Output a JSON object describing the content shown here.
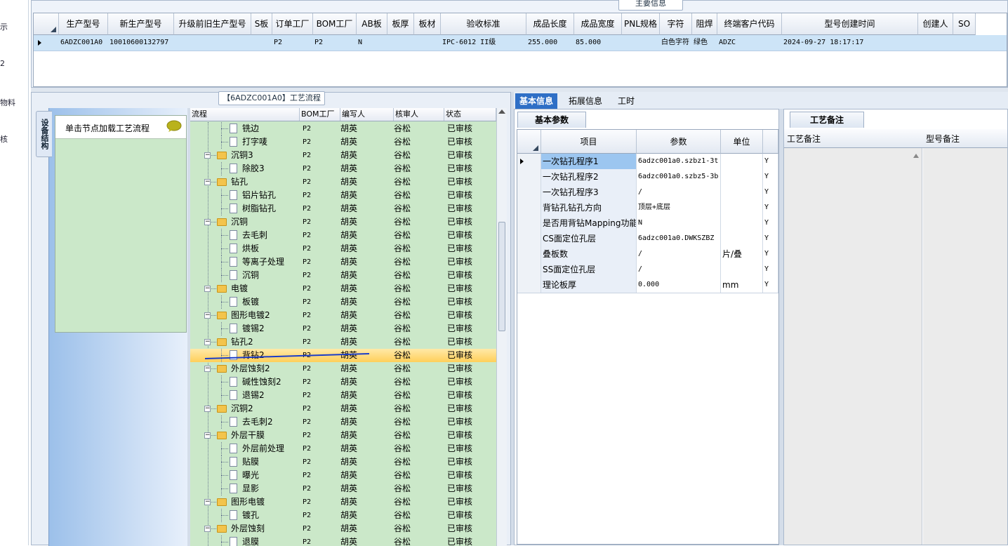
{
  "left_strip": [
    "示",
    "2",
    "物料",
    "核"
  ],
  "top": {
    "title": "主要信息",
    "columns": [
      "生产型号",
      "新生产型号",
      "升级前旧生产型号",
      "S板",
      "订单工厂",
      "BOM工厂",
      "AB板",
      "板厚",
      "板材",
      "验收标准",
      "成品长度",
      "成品宽度",
      "PNL规格",
      "字符",
      "阻焊",
      "终端客户代码",
      "型号创建时间",
      "创建人",
      "SO"
    ],
    "row": [
      "6ADZC001A0",
      "10010600132797",
      "",
      "",
      "P2",
      "P2",
      "N",
      "",
      "",
      "IPC-6012 II级",
      "255.000",
      "85.000",
      "",
      "白色字符",
      "绿色",
      "ADZC",
      "2024-09-27 18:17:17",
      "",
      ""
    ]
  },
  "process": {
    "title": "【6ADZC001A0】工艺流程",
    "side_tab": "设备结构",
    "hint": "单击节点加载工艺流程",
    "columns": [
      "流程",
      "BOM工厂",
      "编写人",
      "核审人",
      "状态"
    ],
    "rows": [
      {
        "name": "铣边",
        "level": 2,
        "bom": "P2",
        "author": "胡英",
        "reviewer": "谷松",
        "status": "已审核"
      },
      {
        "name": "打字唛",
        "level": 2,
        "bom": "P2",
        "author": "胡英",
        "reviewer": "谷松",
        "status": "已审核"
      },
      {
        "name": "沉铜3",
        "level": 1,
        "bom": "P2",
        "author": "胡英",
        "reviewer": "谷松",
        "status": "已审核"
      },
      {
        "name": "除胶3",
        "level": 2,
        "bom": "P2",
        "author": "胡英",
        "reviewer": "谷松",
        "status": "已审核"
      },
      {
        "name": "钻孔",
        "level": 1,
        "bom": "P2",
        "author": "胡英",
        "reviewer": "谷松",
        "status": "已审核"
      },
      {
        "name": "铝片钻孔",
        "level": 2,
        "bom": "P2",
        "author": "胡英",
        "reviewer": "谷松",
        "status": "已审核"
      },
      {
        "name": "树脂钻孔",
        "level": 2,
        "bom": "P2",
        "author": "胡英",
        "reviewer": "谷松",
        "status": "已审核"
      },
      {
        "name": "沉铜",
        "level": 1,
        "bom": "P2",
        "author": "胡英",
        "reviewer": "谷松",
        "status": "已审核"
      },
      {
        "name": "去毛刺",
        "level": 2,
        "bom": "P2",
        "author": "胡英",
        "reviewer": "谷松",
        "status": "已审核"
      },
      {
        "name": "烘板",
        "level": 2,
        "bom": "P2",
        "author": "胡英",
        "reviewer": "谷松",
        "status": "已审核"
      },
      {
        "name": "等离子处理",
        "level": 2,
        "bom": "P2",
        "author": "胡英",
        "reviewer": "谷松",
        "status": "已审核"
      },
      {
        "name": "沉铜",
        "level": 2,
        "bom": "P2",
        "author": "胡英",
        "reviewer": "谷松",
        "status": "已审核"
      },
      {
        "name": "电镀",
        "level": 1,
        "bom": "P2",
        "author": "胡英",
        "reviewer": "谷松",
        "status": "已审核"
      },
      {
        "name": "板镀",
        "level": 2,
        "bom": "P2",
        "author": "胡英",
        "reviewer": "谷松",
        "status": "已审核"
      },
      {
        "name": "图形电镀2",
        "level": 1,
        "bom": "P2",
        "author": "胡英",
        "reviewer": "谷松",
        "status": "已审核"
      },
      {
        "name": "镀锡2",
        "level": 2,
        "bom": "P2",
        "author": "胡英",
        "reviewer": "谷松",
        "status": "已审核"
      },
      {
        "name": "钻孔2",
        "level": 1,
        "bom": "P2",
        "author": "胡英",
        "reviewer": "谷松",
        "status": "已审核"
      },
      {
        "name": "背钻2",
        "level": 2,
        "bom": "P2",
        "author": "胡英",
        "reviewer": "谷松",
        "status": "已审核",
        "selected": true
      },
      {
        "name": "外层蚀刻2",
        "level": 1,
        "bom": "P2",
        "author": "胡英",
        "reviewer": "谷松",
        "status": "已审核"
      },
      {
        "name": "碱性蚀刻2",
        "level": 2,
        "bom": "P2",
        "author": "胡英",
        "reviewer": "谷松",
        "status": "已审核"
      },
      {
        "name": "退锡2",
        "level": 2,
        "bom": "P2",
        "author": "胡英",
        "reviewer": "谷松",
        "status": "已审核"
      },
      {
        "name": "沉铜2",
        "level": 1,
        "bom": "P2",
        "author": "胡英",
        "reviewer": "谷松",
        "status": "已审核"
      },
      {
        "name": "去毛刺2",
        "level": 2,
        "bom": "P2",
        "author": "胡英",
        "reviewer": "谷松",
        "status": "已审核"
      },
      {
        "name": "外层干膜",
        "level": 1,
        "bom": "P2",
        "author": "胡英",
        "reviewer": "谷松",
        "status": "已审核"
      },
      {
        "name": "外层前处理",
        "level": 2,
        "bom": "P2",
        "author": "胡英",
        "reviewer": "谷松",
        "status": "已审核"
      },
      {
        "name": "贴膜",
        "level": 2,
        "bom": "P2",
        "author": "胡英",
        "reviewer": "谷松",
        "status": "已审核"
      },
      {
        "name": "曝光",
        "level": 2,
        "bom": "P2",
        "author": "胡英",
        "reviewer": "谷松",
        "status": "已审核"
      },
      {
        "name": "显影",
        "level": 2,
        "bom": "P2",
        "author": "胡英",
        "reviewer": "谷松",
        "status": "已审核"
      },
      {
        "name": "图形电镀",
        "level": 1,
        "bom": "P2",
        "author": "胡英",
        "reviewer": "谷松",
        "status": "已审核"
      },
      {
        "name": "镀孔",
        "level": 2,
        "bom": "P2",
        "author": "胡英",
        "reviewer": "谷松",
        "status": "已审核"
      },
      {
        "name": "外层蚀刻",
        "level": 1,
        "bom": "P2",
        "author": "胡英",
        "reviewer": "谷松",
        "status": "已审核"
      },
      {
        "name": "退膜",
        "level": 2,
        "bom": "P2",
        "author": "胡英",
        "reviewer": "谷松",
        "status": "已审核"
      }
    ]
  },
  "tabs": [
    "基本信息",
    "拓展信息",
    "工时"
  ],
  "basic": {
    "tab": "基本参数",
    "columns": [
      "项目",
      "参数",
      "单位"
    ],
    "rows": [
      {
        "item": "一次钻孔程序1",
        "param": "6adzc001a0.szbz1-3t",
        "unit": "",
        "flag": "Y"
      },
      {
        "item": "一次钻孔程序2",
        "param": "6adzc001a0.szbz5-3b",
        "unit": "",
        "flag": "Y"
      },
      {
        "item": "一次钻孔程序3",
        "param": "/",
        "unit": "",
        "flag": "Y"
      },
      {
        "item": "背钻孔钻孔方向",
        "param": "顶层+底层",
        "unit": "",
        "flag": "Y"
      },
      {
        "item": "是否用背钻Mapping功能",
        "param": "N",
        "unit": "",
        "flag": "Y"
      },
      {
        "item": "CS面定位孔层",
        "param": "6adzc001a0.DWKSZBZ",
        "unit": "",
        "flag": "Y"
      },
      {
        "item": "叠板数",
        "param": "/",
        "unit": "片/叠",
        "flag": "Y"
      },
      {
        "item": "SS面定位孔层",
        "param": "/",
        "unit": "",
        "flag": "Y"
      },
      {
        "item": "理论板厚",
        "param": "0.000",
        "unit": "mm",
        "flag": "Y"
      }
    ]
  },
  "notes": {
    "tab": "工艺备注",
    "columns": [
      "工艺备注",
      "型号备注"
    ]
  },
  "colors": {
    "selection": "#ffd36a",
    "tree_bg": "#cbe8c9",
    "active_tab": "#2f6fc6",
    "annotation": "#1a3cc8"
  }
}
